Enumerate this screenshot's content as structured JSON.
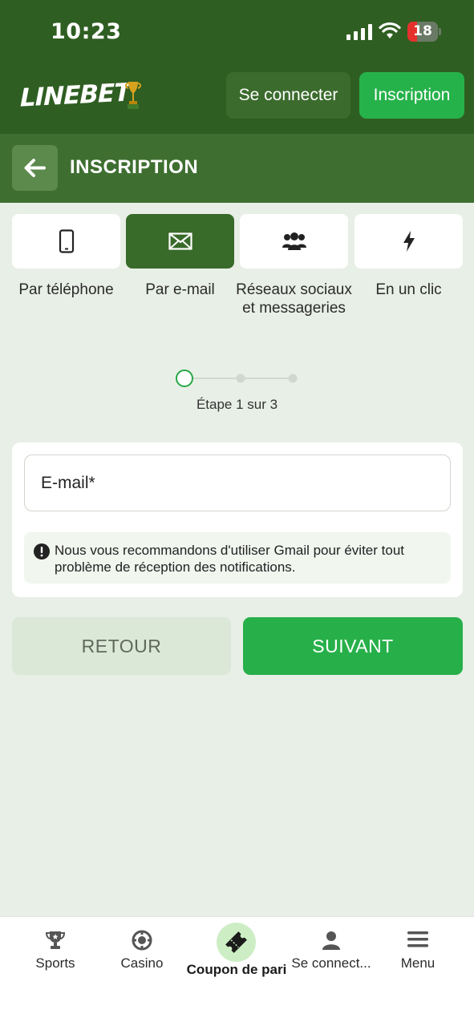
{
  "status_bar": {
    "time": "10:23",
    "battery": "18"
  },
  "header": {
    "logo": "LINEBET",
    "login_label": "Se connecter",
    "signup_label": "Inscription"
  },
  "subheader": {
    "title": "INSCRIPTION"
  },
  "methods": [
    {
      "label": "Par téléphone",
      "icon": "phone-icon",
      "active": false
    },
    {
      "label": "Par e-mail",
      "icon": "envelope-icon",
      "active": true
    },
    {
      "label": "Réseaux sociaux et messageries",
      "icon": "users-icon",
      "active": false
    },
    {
      "label": "En un clic",
      "icon": "lightning-icon",
      "active": false
    }
  ],
  "steps": {
    "current": 1,
    "total": 3,
    "label": "Étape 1 sur 3"
  },
  "form": {
    "email_placeholder": "E-mail*",
    "notice": "Nous vous recommandons d'utiliser Gmail pour éviter tout problème de réception des notifications."
  },
  "buttons": {
    "back": "RETOUR",
    "next": "SUIVANT"
  },
  "bottom_nav": {
    "sports": "Sports",
    "casino": "Casino",
    "coupon": "Coupon de pari",
    "login": "Se connect...",
    "menu": "Menu"
  },
  "colors": {
    "header": "#2f5e22",
    "subheader": "#3e6f30",
    "accent_green": "#27b04a",
    "active_tab": "#386a29",
    "background": "#e8efe6"
  }
}
